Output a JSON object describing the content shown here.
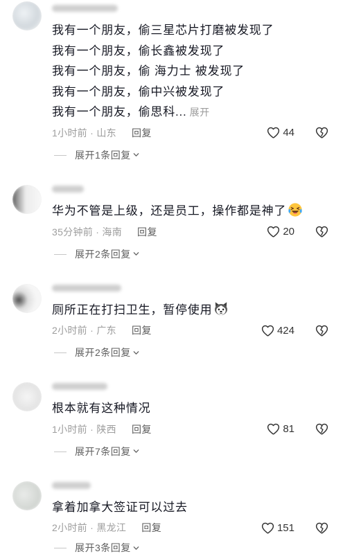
{
  "icons": {
    "like": "heart-outline-icon",
    "dislike": "broken-heart-icon",
    "expand_replies": "chevron-down-icon"
  },
  "comments": [
    {
      "lines": [
        "我有一个朋友，偷三星芯片打磨被发现了",
        "我有一个朋友，偷长鑫被发现了",
        "我有一个朋友，偷 海力士 被发现了",
        "我有一个朋友，偷中兴被发现了",
        "我有一个朋友，偷思科..."
      ],
      "more_label": "展开",
      "meta": "1小时前 · 山东",
      "reply_label": "回复",
      "likes": 44,
      "replies_label": "展开1条回复"
    },
    {
      "lines": [
        "华为不管是上级，还是员工，操作都是神了"
      ],
      "emoji": "laughing-crying-emoji",
      "meta": "35分钟前 · 海南",
      "reply_label": "回复",
      "likes": 20,
      "replies_label": "展开2条回复"
    },
    {
      "lines": [
        "厕所正在打扫卫生，暂停使用"
      ],
      "emoji": "husky-dog-emoji",
      "meta": "2小时前 · 广东",
      "reply_label": "回复",
      "likes": 424,
      "replies_label": "展开2条回复"
    },
    {
      "lines": [
        "根本就有这种情况"
      ],
      "meta": "1小时前 · 陕西",
      "reply_label": "回复",
      "likes": 81,
      "replies_label": "展开7条回复"
    },
    {
      "lines": [
        "拿着加拿大签证可以过去"
      ],
      "meta": "2小时前 · 黑龙江",
      "reply_label": "回复",
      "likes": 151,
      "replies_label": "展开3条回复"
    }
  ]
}
